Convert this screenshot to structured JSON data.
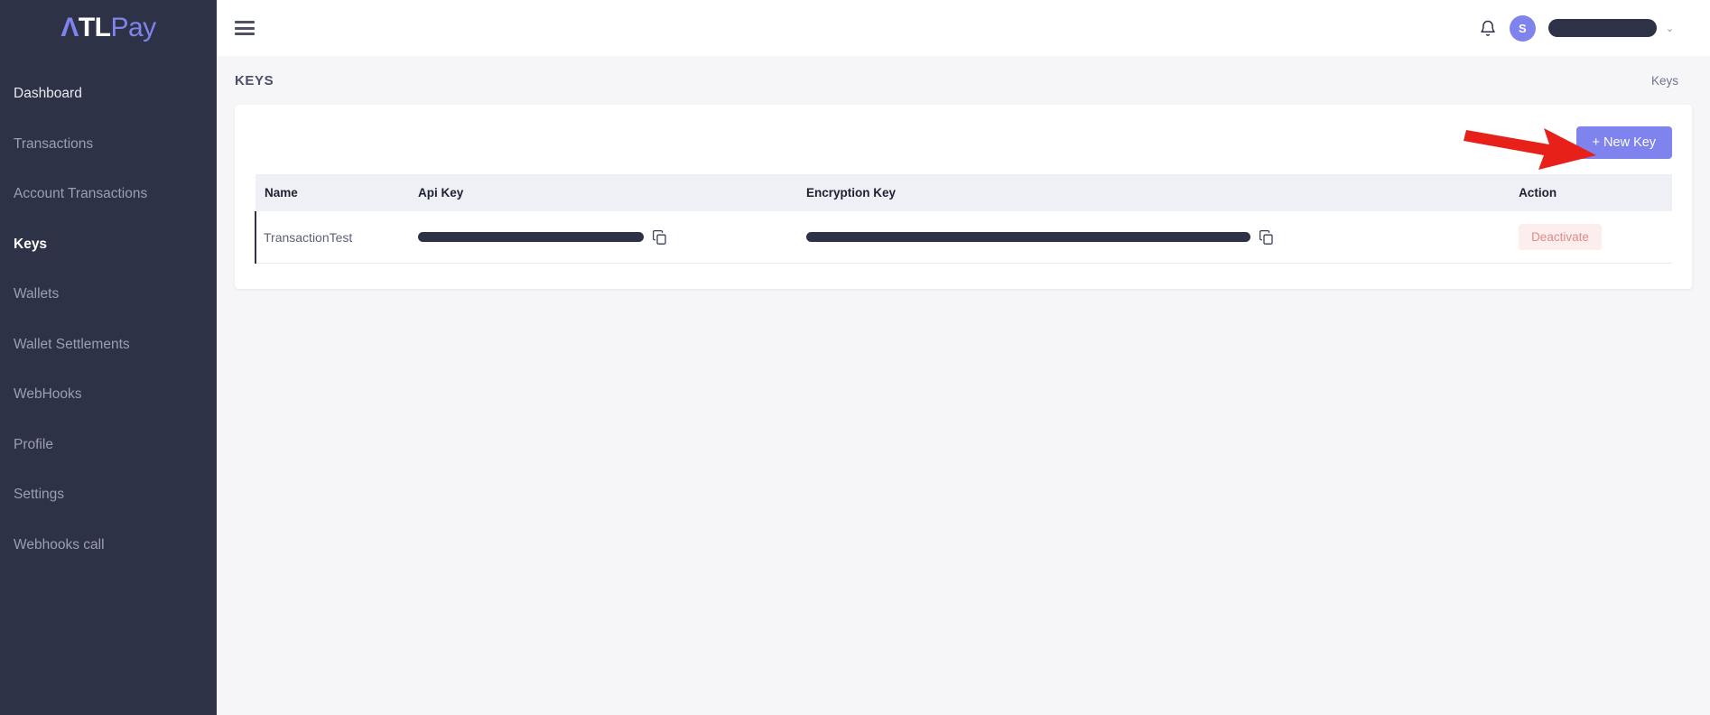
{
  "brand": {
    "logo_a": "Λ",
    "logo_tl": "TL",
    "logo_pay": "Pay"
  },
  "sidebar": {
    "items": [
      {
        "label": "Dashboard",
        "state": "bright"
      },
      {
        "label": "Transactions",
        "state": "normal"
      },
      {
        "label": "Account Transactions",
        "state": "normal"
      },
      {
        "label": "Keys",
        "state": "active"
      },
      {
        "label": "Wallets",
        "state": "normal"
      },
      {
        "label": "Wallet Settlements",
        "state": "normal"
      },
      {
        "label": "WebHooks",
        "state": "normal"
      },
      {
        "label": "Profile",
        "state": "normal"
      },
      {
        "label": "Settings",
        "state": "normal"
      },
      {
        "label": "Webhooks call",
        "state": "normal"
      }
    ]
  },
  "topbar": {
    "menu_icon": "hamburger-icon",
    "notification_icon": "bell-icon",
    "avatar_initial": "S",
    "username": "",
    "caret": "⌄"
  },
  "page": {
    "title": "KEYS",
    "breadcrumb": "Keys"
  },
  "toolbar": {
    "new_key_label": "+ New Key"
  },
  "table": {
    "columns": [
      "Name",
      "Api Key",
      "Encryption Key",
      "Action"
    ],
    "rows": [
      {
        "name": "TransactionTest",
        "api_key": "",
        "encryption_key": "",
        "action_label": "Deactivate"
      }
    ]
  },
  "annotation": {
    "type": "red-arrow",
    "points_to": "+ New Key",
    "color": "#e8201a"
  },
  "colors": {
    "sidebar_bg": "#2e3246",
    "accent_purple": "#7f83ee",
    "page_bg": "#f6f6f9",
    "card_bg": "#ffffff",
    "table_header_bg": "#eef0f6",
    "deactivate_bg": "#fdeeee",
    "deactivate_text": "#e08b8b",
    "annotation_red": "#e8201a"
  }
}
